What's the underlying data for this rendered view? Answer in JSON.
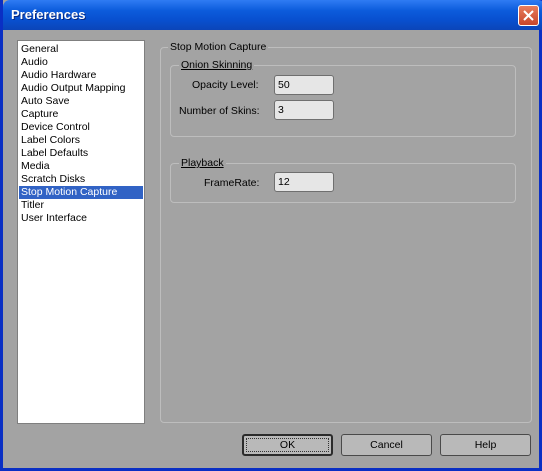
{
  "window": {
    "title": "Preferences"
  },
  "sidebar": {
    "items": [
      {
        "label": "General"
      },
      {
        "label": "Audio"
      },
      {
        "label": "Audio Hardware"
      },
      {
        "label": "Audio Output Mapping"
      },
      {
        "label": "Auto Save"
      },
      {
        "label": "Capture"
      },
      {
        "label": "Device Control"
      },
      {
        "label": "Label Colors"
      },
      {
        "label": "Label Defaults"
      },
      {
        "label": "Media"
      },
      {
        "label": "Scratch Disks"
      },
      {
        "label": "Stop Motion Capture"
      },
      {
        "label": "Titler"
      },
      {
        "label": "User Interface"
      }
    ],
    "selected": "Stop Motion Capture"
  },
  "panel": {
    "title": "Stop Motion Capture",
    "onion_skinning": {
      "title": "Onion Skinning",
      "opacity_label": "Opacity Level:",
      "opacity_value": "50",
      "skins_label": "Number of Skins:",
      "skins_value": "3"
    },
    "playback": {
      "title": "Playback",
      "framerate_label": "FrameRate:",
      "framerate_value": "12"
    }
  },
  "buttons": {
    "ok": "OK",
    "cancel": "Cancel",
    "help": "Help"
  },
  "colors": {
    "titlebar": "#0850d0",
    "selection": "#3163c5",
    "background": "#a3a3a3"
  }
}
